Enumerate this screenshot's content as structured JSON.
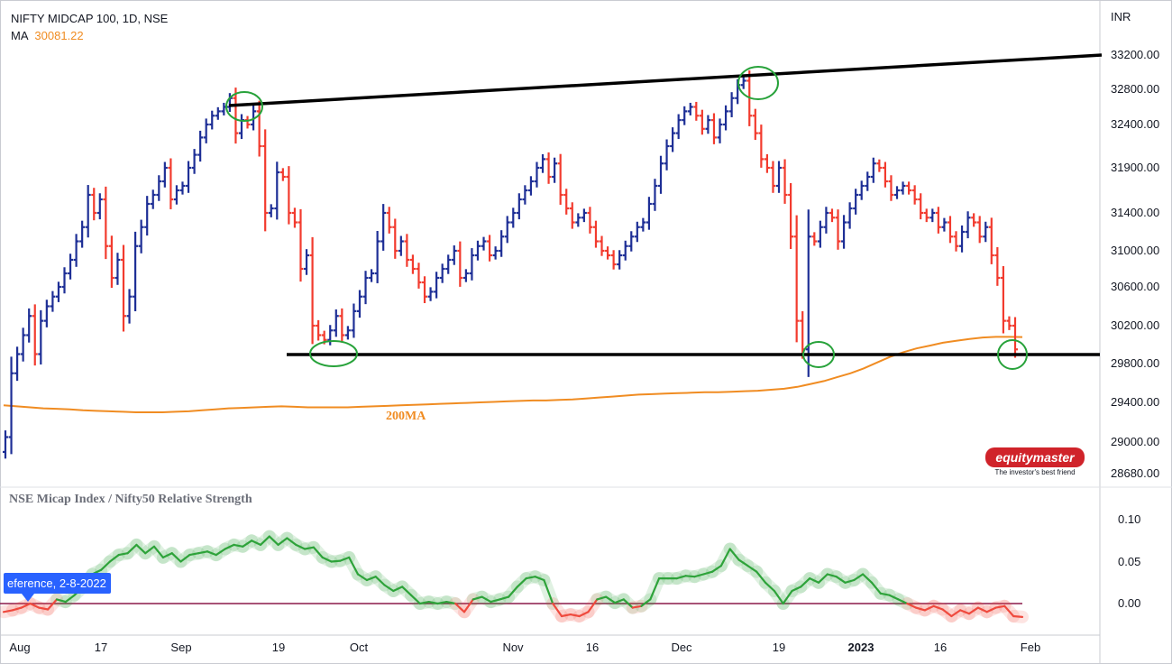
{
  "header": {
    "symbol_line": "NIFTY MIDCAP 100, 1D, NSE",
    "ma_label": "MA",
    "ma_value": "30081.22"
  },
  "colors": {
    "up": "#1e2f96",
    "down": "#f23b2e",
    "ma": "#f08c22",
    "trend": "#000000",
    "circle": "#27a23a",
    "rs_up": "#2ea33a",
    "rs_down": "#ef4a3e",
    "rs_zero": "#8b1a4a"
  },
  "price_axis": {
    "unit": "INR",
    "ticks": [
      "33200.00",
      "32800.00",
      "32400.00",
      "31900.00",
      "31400.00",
      "31000.00",
      "30600.00",
      "30200.00",
      "29800.00",
      "29400.00",
      "29000.00",
      "28680.00"
    ]
  },
  "rs_axis": {
    "ticks": [
      "0.10",
      "0.05",
      "0.00"
    ]
  },
  "time_axis": {
    "labels": [
      "Aug",
      "17",
      "Sep",
      "19",
      "Oct",
      "Nov",
      "16",
      "Dec",
      "19",
      "2023",
      "16",
      "Feb"
    ]
  },
  "annotations": {
    "ma_tag": "200MA",
    "rs_title": "NSE Micap Index / Nifty50 Relative Strength",
    "reference_tag": "eference, 2-8-2022"
  },
  "logo": {
    "name": "equitymaster",
    "tagline": "The investor's best friend"
  },
  "chart_data": [
    {
      "type": "ohlc",
      "title": "NIFTY MIDCAP 100, 1D, NSE",
      "unit": "INR",
      "x_labels": [
        "Aug",
        "17",
        "Sep",
        "19",
        "Oct",
        "Nov",
        "16",
        "Dec",
        "19",
        "2023",
        "16",
        "Feb"
      ],
      "ylim": [
        28680,
        33200
      ],
      "close": [
        29050,
        29700,
        29900,
        30100,
        30300,
        29900,
        30250,
        30400,
        30500,
        30600,
        30750,
        30900,
        31100,
        31250,
        31600,
        31400,
        31550,
        31050,
        30700,
        30900,
        30300,
        30500,
        31050,
        31250,
        31500,
        31600,
        31750,
        31900,
        31550,
        31650,
        31700,
        31900,
        32050,
        32250,
        32400,
        32500,
        32550,
        32600,
        32700,
        32300,
        32450,
        32400,
        32550,
        32150,
        31400,
        31450,
        31850,
        31800,
        31400,
        31300,
        30800,
        30950,
        30200,
        30100,
        30050,
        30150,
        30300,
        30100,
        30150,
        30350,
        30500,
        30700,
        30750,
        31100,
        31400,
        31250,
        31000,
        31100,
        30900,
        30800,
        30650,
        30500,
        30550,
        30700,
        30800,
        30900,
        31000,
        30700,
        30750,
        30950,
        31050,
        31100,
        30950,
        31000,
        31150,
        31300,
        31400,
        31550,
        31650,
        31750,
        31900,
        32000,
        31800,
        31950,
        31600,
        31450,
        31300,
        31350,
        31400,
        31250,
        31100,
        31000,
        30950,
        30850,
        30950,
        31050,
        31150,
        31250,
        31300,
        31500,
        31700,
        31950,
        32150,
        32300,
        32450,
        32550,
        32600,
        32500,
        32350,
        32450,
        32250,
        32400,
        32550,
        32700,
        32850,
        32900,
        32500,
        32300,
        32000,
        31900,
        31700,
        31900,
        31600,
        31150,
        30250,
        29950,
        31150,
        31100,
        31250,
        31400,
        31350,
        31100,
        31300,
        31450,
        31600,
        31700,
        31800,
        31950,
        31900,
        31750,
        31600,
        31650,
        31700,
        31650,
        31550,
        31400,
        31350,
        31400,
        31250,
        31300,
        31150,
        31050,
        31200,
        31350,
        31300,
        31150,
        31250,
        30950,
        30700,
        30250,
        30200,
        29950
      ],
      "series": [
        {
          "name": "MA",
          "color": "#f08c22",
          "values": [
            29370,
            29360,
            29350,
            29340,
            29335,
            29330,
            29320,
            29315,
            29310,
            29305,
            29300,
            29300,
            29300,
            29305,
            29310,
            29320,
            29330,
            29340,
            29345,
            29350,
            29355,
            29360,
            29355,
            29350,
            29350,
            29350,
            29350,
            29355,
            29360,
            29365,
            29370,
            29375,
            29380,
            29385,
            29390,
            29395,
            29400,
            29405,
            29410,
            29415,
            29420,
            29420,
            29425,
            29430,
            29440,
            29450,
            29460,
            29470,
            29480,
            29485,
            29490,
            29495,
            29500,
            29505,
            29505,
            29510,
            29515,
            29520,
            29530,
            29540,
            29560,
            29590,
            29620,
            29660,
            29700,
            29750,
            29810,
            29870,
            29920,
            29960,
            29990,
            30020,
            30040,
            30060,
            30075,
            30082,
            30082,
            30080
          ]
        }
      ]
    },
    {
      "type": "line",
      "title": "NSE Micap Index / Nifty50 Relative Strength",
      "ylim": [
        -0.02,
        0.1
      ],
      "series": [
        {
          "name": "NSE Micap Index / Nifty50 Relative Strength",
          "values": [
            -0.01,
            -0.008,
            -0.005,
            0.0,
            -0.005,
            -0.007,
            0.005,
            0.002,
            0.01,
            0.02,
            0.035,
            0.04,
            0.05,
            0.058,
            0.06,
            0.07,
            0.06,
            0.068,
            0.055,
            0.06,
            0.05,
            0.058,
            0.06,
            0.062,
            0.058,
            0.065,
            0.07,
            0.068,
            0.075,
            0.07,
            0.08,
            0.07,
            0.078,
            0.07,
            0.065,
            0.067,
            0.055,
            0.05,
            0.051,
            0.055,
            0.035,
            0.028,
            0.032,
            0.022,
            0.015,
            0.02,
            0.01,
            0.0,
            0.002,
            0.0,
            0.002,
            0.0,
            -0.01,
            0.005,
            0.008,
            0.002,
            0.005,
            0.008,
            0.02,
            0.03,
            0.032,
            0.028,
            0.0,
            -0.015,
            -0.013,
            -0.015,
            -0.01,
            0.005,
            0.008,
            0.001,
            0.005,
            -0.005,
            -0.003,
            0.005,
            0.03,
            0.03,
            0.03,
            0.033,
            0.032,
            0.035,
            0.038,
            0.045,
            0.065,
            0.052,
            0.045,
            0.038,
            0.025,
            0.015,
            0.0,
            0.015,
            0.02,
            0.03,
            0.025,
            0.035,
            0.032,
            0.025,
            0.028,
            0.035,
            0.025,
            0.012,
            0.01,
            0.005,
            0.0,
            -0.005,
            -0.008,
            -0.003,
            -0.007,
            -0.015,
            -0.008,
            -0.012,
            -0.005,
            -0.01,
            -0.005,
            -0.003,
            -0.015,
            -0.016
          ]
        }
      ]
    }
  ]
}
